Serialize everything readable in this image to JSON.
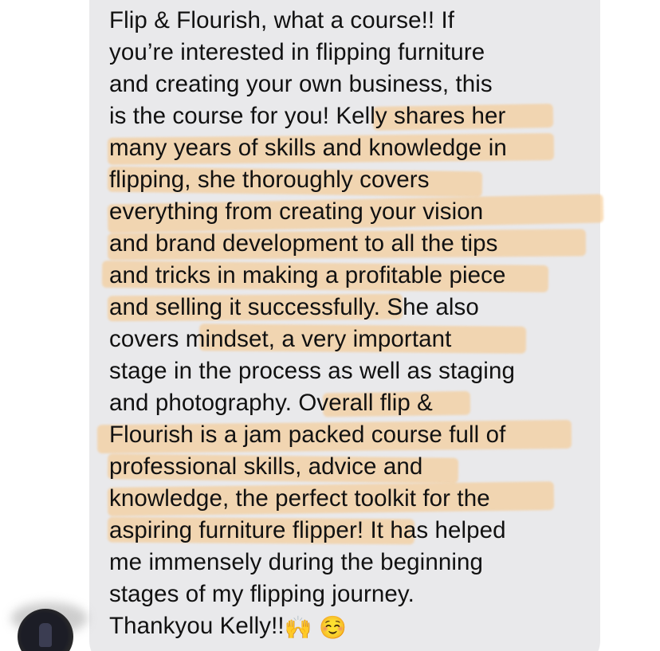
{
  "message": {
    "text": "Flip & Flourish, what a course!! If\nyou’re interested in flipping furniture\nand creating your own business, this\nis the course for you! Kelly shares her\nmany years of skills and knowledge in\nflipping, she thoroughly covers\neverything from creating your vision\nand brand development to all the tips\nand tricks in making a profitable piece\nand selling it successfully. She also\ncovers mindset, a very important\nstage in the process as well as staging\nand photography. Overall flip &\nFlourish is a jam packed course full of\nprofessional skills, advice and\nknowledge, the perfect toolkit for the\naspiring furniture flipper! It has helped\nme immensely during the beginning\nstages of my flipping journey.\nThankyou Kelly!!",
    "emojis": [
      "🙌",
      "☺️"
    ],
    "bubble_color": "#e9e9eb",
    "highlight_color": "#f6c98f"
  },
  "sender": {
    "avatar_icon": "contact-avatar-photo"
  }
}
